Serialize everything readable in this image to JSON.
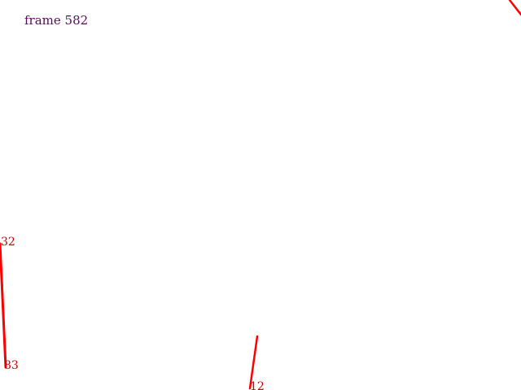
{
  "frame": {
    "label": "frame 582"
  },
  "markers": [
    {
      "id": "marker-32",
      "label": "32"
    },
    {
      "id": "marker-83",
      "label": "83"
    },
    {
      "id": "marker-12",
      "label": "12"
    }
  ],
  "colors": {
    "background": "#ffffff",
    "frame_label": "#5a0a5a",
    "line": "#ff0000",
    "marker_label": "#cc0000"
  }
}
